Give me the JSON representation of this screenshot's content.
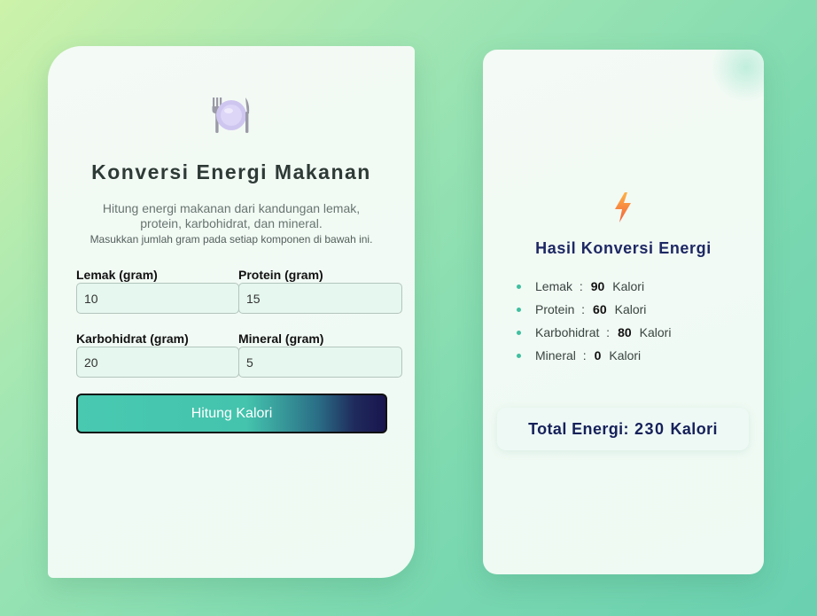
{
  "converter": {
    "title": "Konversi Energi Makanan",
    "description": "Hitung energi makanan dari kandungan lemak, protein, karbohidrat, dan mineral.",
    "note": "Masukkan jumlah gram pada setiap komponen di bawah ini.",
    "icon": "plate-cutlery-icon",
    "fields": {
      "fat": {
        "label": "Lemak (gram)",
        "value": "10"
      },
      "protein": {
        "label": "Protein (gram)",
        "value": "15"
      },
      "carbs": {
        "label": "Karbohidrat (gram)",
        "value": "20"
      },
      "mineral": {
        "label": "Mineral (gram)",
        "value": "5"
      }
    },
    "button_label": "Hitung Kalori"
  },
  "result": {
    "icon": "lightning-icon",
    "title": "Hasil Konversi Energi",
    "items": [
      {
        "name": "Lemak",
        "sep": ":",
        "value": "90",
        "unit": "Kalori"
      },
      {
        "name": "Protein",
        "sep": ":",
        "value": "60",
        "unit": "Kalori"
      },
      {
        "name": "Karbohidrat",
        "sep": ":",
        "value": "80",
        "unit": "Kalori"
      },
      {
        "name": "Mineral",
        "sep": ":",
        "value": "0",
        "unit": "Kalori"
      }
    ],
    "total_label": "Total Energi:",
    "total_value": "230",
    "total_unit": "Kalori"
  },
  "colors": {
    "accent_start": "#48c9b0",
    "accent_end": "#19154e",
    "heading": "#1d2863"
  }
}
